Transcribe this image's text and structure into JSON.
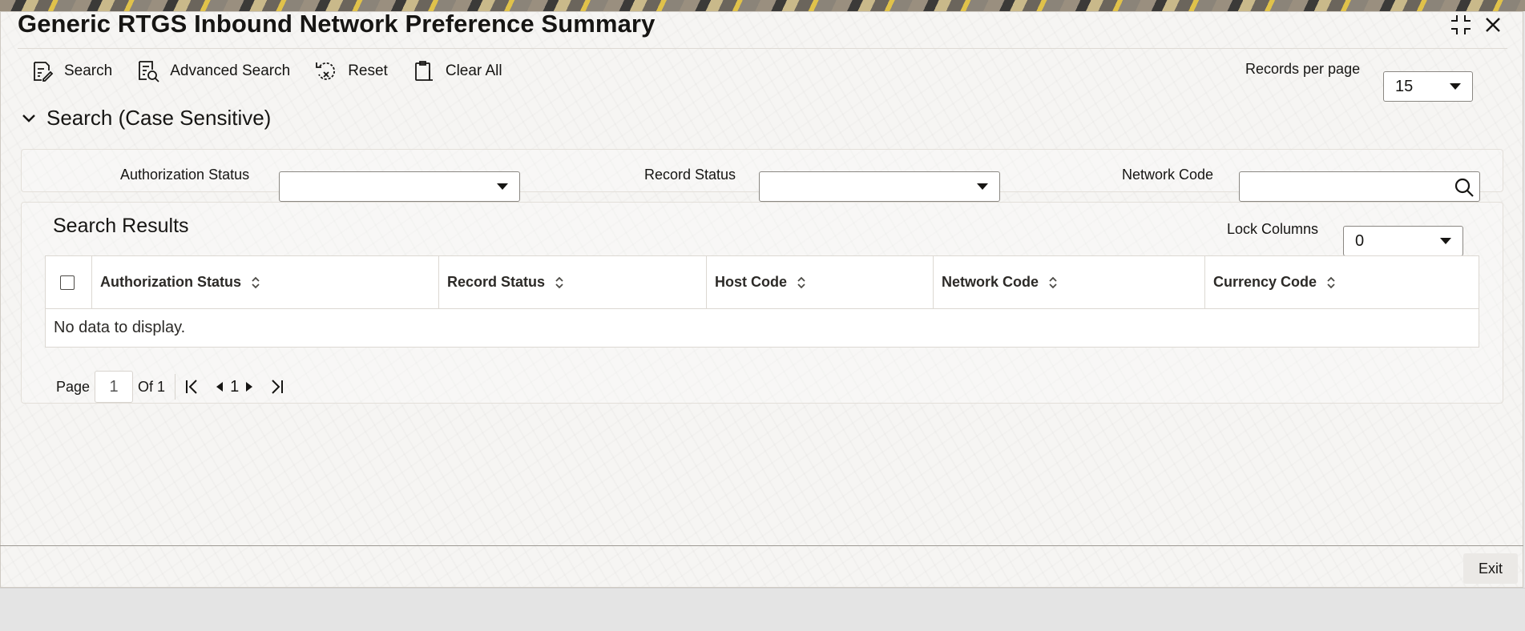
{
  "window": {
    "title": "Generic RTGS Inbound Network Preference Summary"
  },
  "toolbar": {
    "search_label": "Search",
    "advanced_search_label": "Advanced Search",
    "reset_label": "Reset",
    "clear_all_label": "Clear All"
  },
  "records_per_page": {
    "label": "Records per page",
    "value": "15"
  },
  "search_section": {
    "title": "Search (Case Sensitive)",
    "fields": {
      "authorization_status": {
        "label": "Authorization Status",
        "value": ""
      },
      "record_status": {
        "label": "Record Status",
        "value": ""
      },
      "network_code": {
        "label": "Network Code",
        "value": ""
      }
    }
  },
  "results": {
    "title": "Search Results",
    "lock_columns_label": "Lock Columns",
    "lock_columns_value": "0",
    "columns": [
      "Authorization Status",
      "Record Status",
      "Host Code",
      "Network Code",
      "Currency Code"
    ],
    "empty_text": "No data to display."
  },
  "pagination": {
    "page_label": "Page",
    "current_page": "1",
    "of_label": "Of 1",
    "page_number": "1"
  },
  "footer": {
    "exit_label": "Exit"
  },
  "icons": {
    "maximize": "shrink-icon",
    "close": "close-icon",
    "search": "search-icon",
    "advanced_search": "advanced-search-icon",
    "reset": "reset-icon",
    "clear_all": "clear-all-icon"
  }
}
